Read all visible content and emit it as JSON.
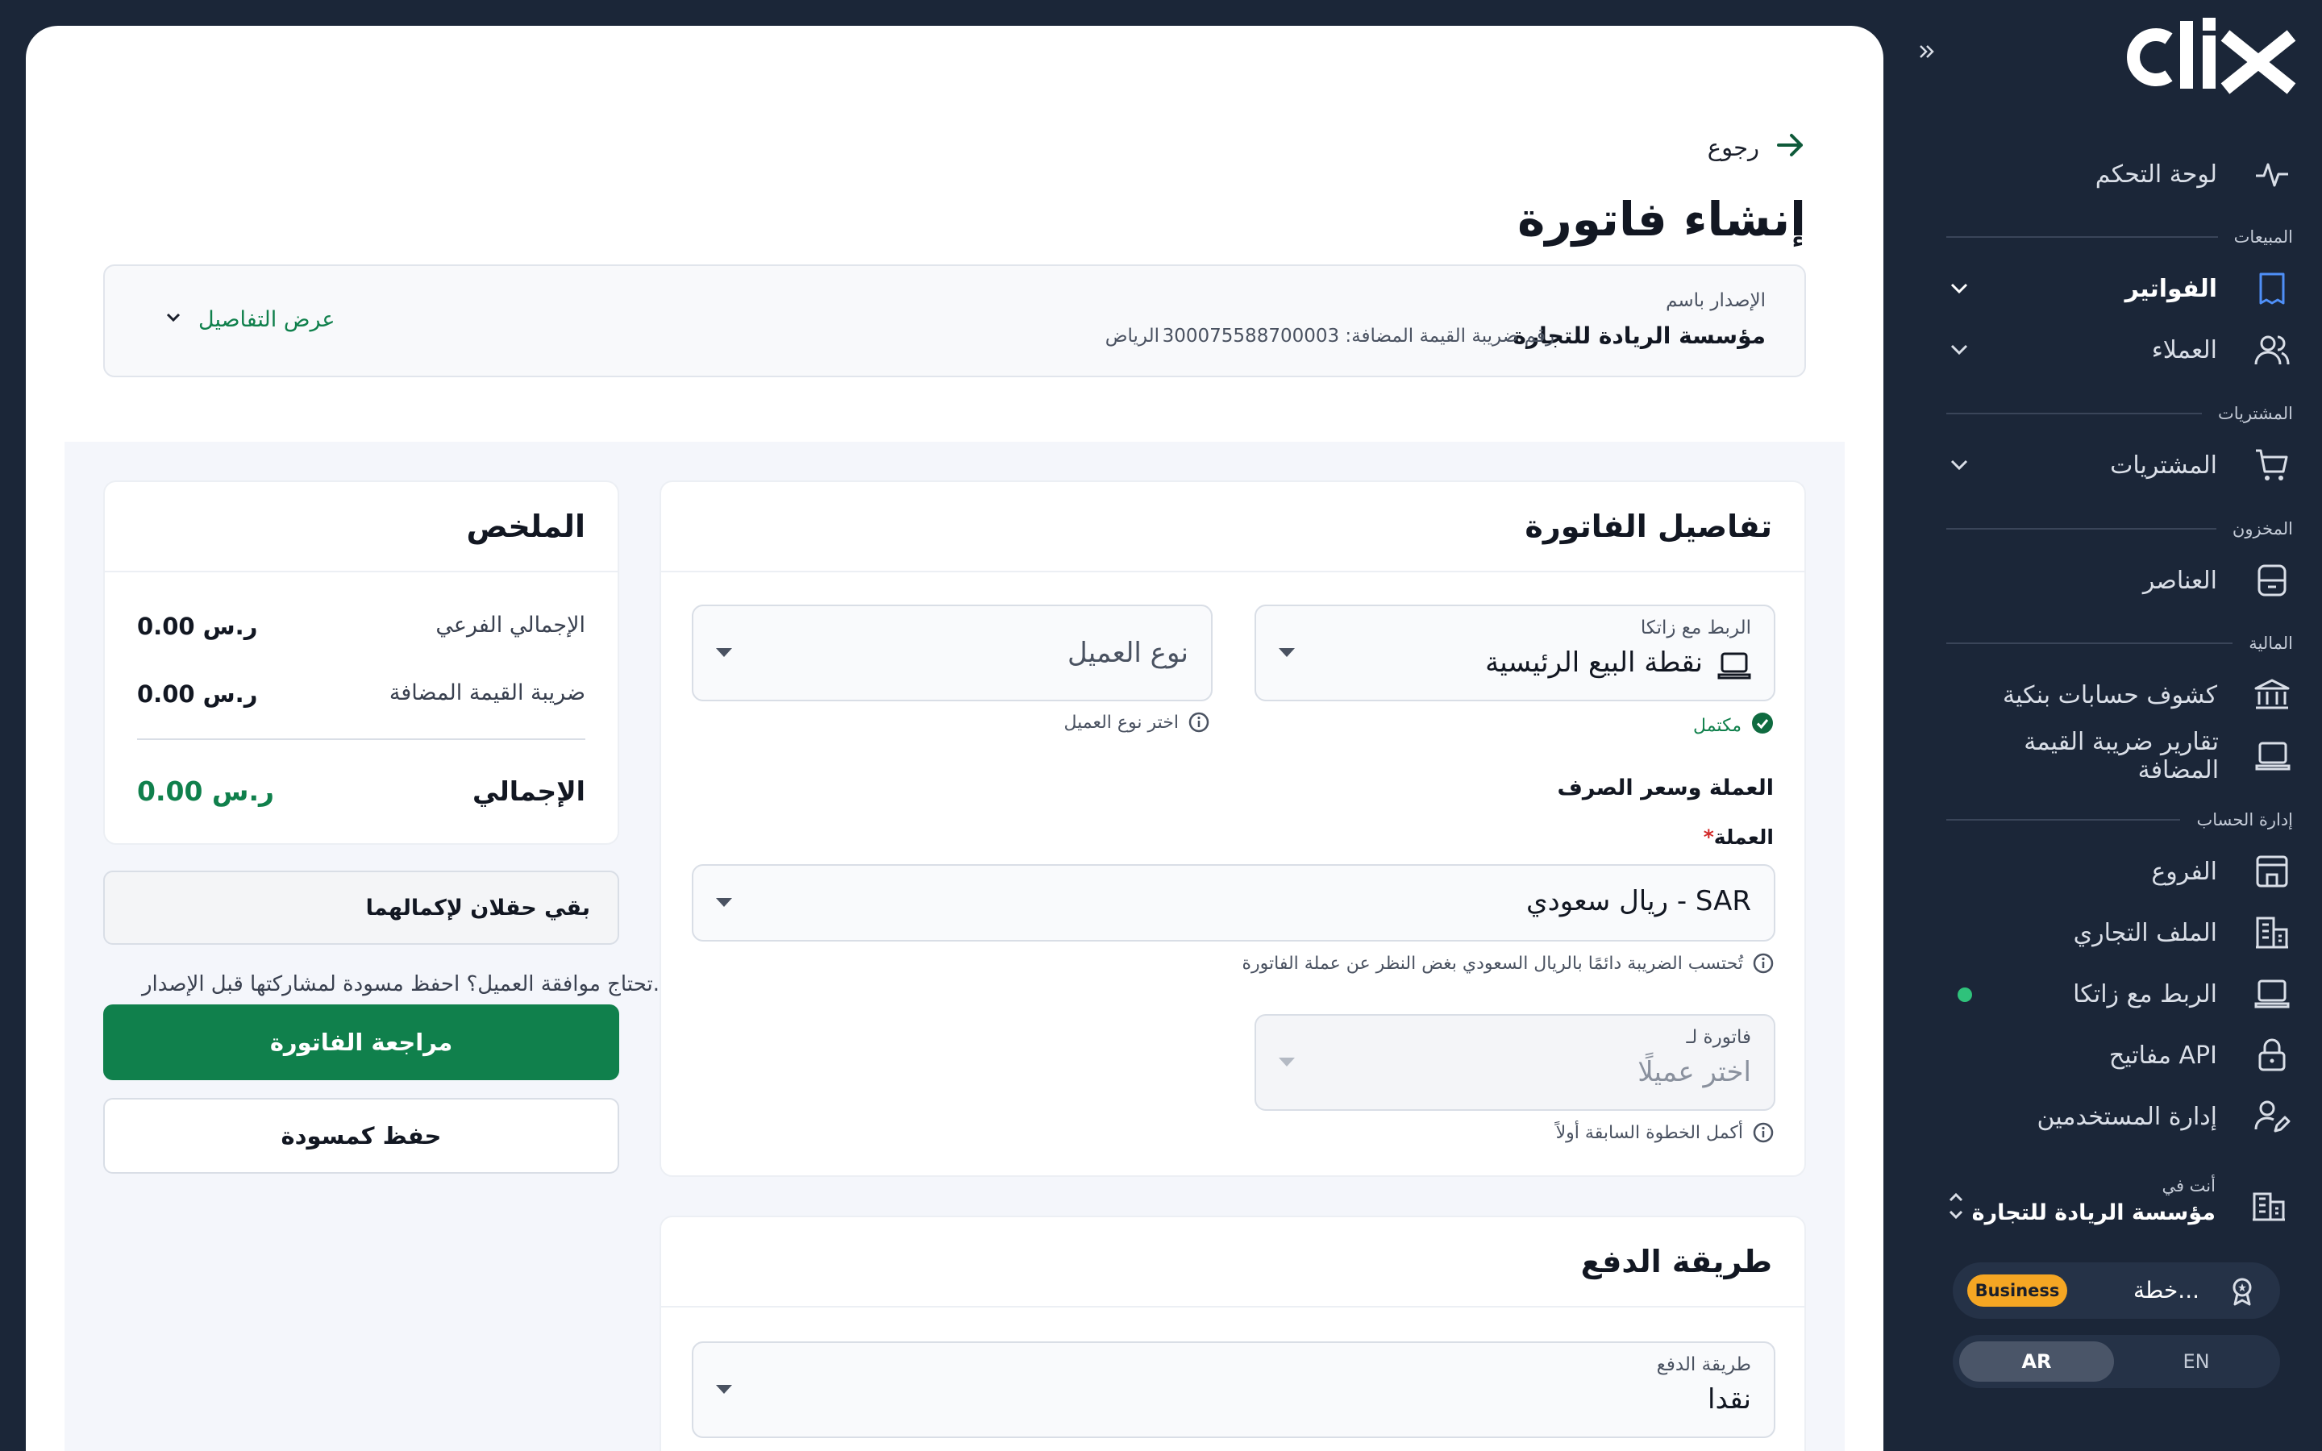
{
  "brand": {
    "logo_text": "clix"
  },
  "sidebar": {
    "dashboard": "لوحة التحكم",
    "sections": {
      "sales": "المبيعات",
      "purchases": "المشتريات",
      "inventory": "المخزون",
      "finance": "المالية",
      "account": "إدارة الحساب"
    },
    "items": {
      "invoices": "الفواتير",
      "customers": "العملاء",
      "purchases": "المشتريات",
      "items": "العناصر",
      "bank_statements": "كشوف حسابات بنكية",
      "vat_reports": "تقارير ضريبة القيمة المضافة",
      "branches": "الفروع",
      "business_profile": "الملف التجاري",
      "zatca_link": "الربط مع زاتكا",
      "api_keys": "مفاتيح API",
      "user_management": "إدارة المستخدمين"
    },
    "org": {
      "caption": "أنت في",
      "name": "مؤسسة الريادة للتجارة"
    },
    "plan": {
      "label": "خطة...",
      "badge": "Business"
    },
    "lang": {
      "ar": "AR",
      "en": "EN"
    }
  },
  "header": {
    "back": "رجوع",
    "title": "إنشاء فاتورة",
    "issuer": {
      "caption": "الإصدار باسم",
      "name": "مؤسسة الريادة للتجارة",
      "vat": "رقم ضريبة القيمة المضافة: 300075588700003",
      "city": "الرياض",
      "details_toggle": "عرض التفاصيل"
    }
  },
  "invoice_details": {
    "title": "تفاصيل الفاتورة",
    "zatca": {
      "label": "الربط مع زاتكا",
      "value": "نقطة البيع الرئيسية",
      "status": "مكتمل"
    },
    "customer_type": {
      "placeholder": "نوع العميل",
      "hint": "اختر نوع العميل"
    },
    "currency_section": "العملة وسعر الصرف",
    "currency": {
      "label": "العملة",
      "required_mark": "*",
      "value": "ريال سعودي - SAR",
      "hint": "تُحتسب الضريبة دائمًا بالريال السعودي بغض النظر عن عملة الفاتورة"
    },
    "invoice_for": {
      "label": "فاتورة لـ",
      "placeholder": "اختر عميلًا",
      "hint": "أكمل الخطوة السابقة أولاً"
    }
  },
  "payment": {
    "title": "طريقة الدفع",
    "method": {
      "label": "طريقة الدفع",
      "value": "نقدا"
    }
  },
  "summary": {
    "title": "الملخص",
    "subtotal_label": "الإجمالي الفرعي",
    "subtotal_value": "ر.س 0.00",
    "vat_label": "ضريبة القيمة المضافة",
    "vat_value": "ر.س 0.00",
    "total_label": "الإجمالي",
    "total_value": "ر.س 0.00",
    "remaining": "بقي حقلان لإكمالهما",
    "note": "تحتاج موافقة العميل؟ احفظ مسودة لمشاركتها قبل الإصدار.",
    "review_button": "مراجعة الفاتورة",
    "draft_button": "حفظ كمسودة"
  },
  "colors": {
    "accent": "#10804c",
    "sidebar_bg": "#1b2638",
    "badge": "#f5a623"
  }
}
